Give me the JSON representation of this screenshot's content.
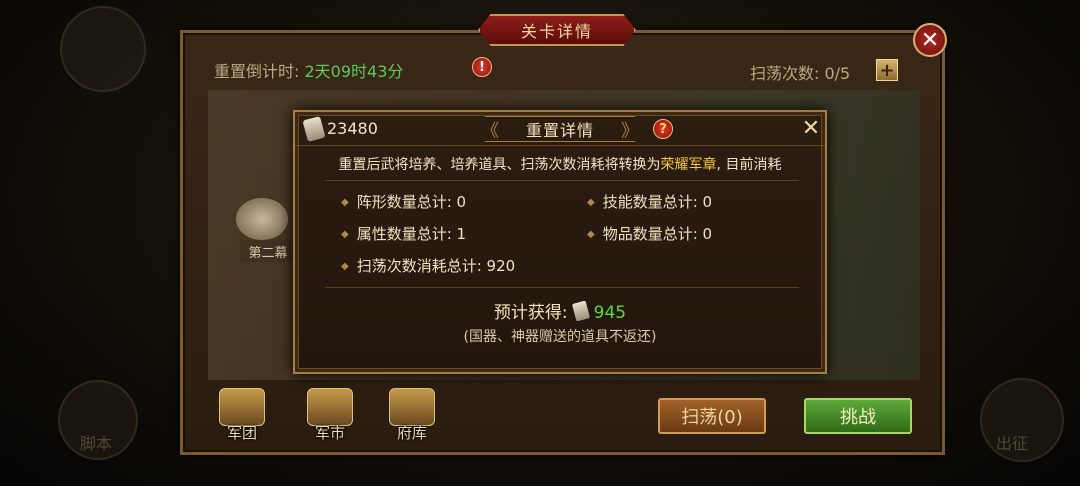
{
  "background": {
    "left_labels": [
      "脚本"
    ],
    "right_labels": [
      "出征"
    ]
  },
  "panel": {
    "title": "关卡详情",
    "reset_label": "重置倒计时:",
    "reset_time": "2天09时43分",
    "sweep_count_label": "扫荡次数: 0/5",
    "chapter_label": "第二幕",
    "bottom_icons": [
      "军团",
      "军市",
      "府库"
    ],
    "sweep_button": "扫荡(0)",
    "fight_button": "挑战"
  },
  "dialog": {
    "token_count": "23480",
    "title": "重置详情",
    "description_prefix": "重置后武将培养、培养道具、扫荡次数消耗将转换为",
    "description_highlight": "荣耀军章",
    "description_suffix": ", 目前消耗",
    "stats": {
      "formation": "阵形数量总计: 0",
      "skill": "技能数量总计: 0",
      "attribute": "属性数量总计: 1",
      "item": "物品数量总计: 0",
      "sweep": "扫荡次数消耗总计: 920"
    },
    "gain_label": "预计获得:",
    "gain_value": "945",
    "note": "(国器、神器赠送的道具不返还)"
  },
  "colors": {
    "accent_gold": "#a97d40",
    "highlight_yellow": "#f4c63a",
    "gain_green": "#58d84a",
    "timer_green": "#5fc95a",
    "title_red": "#8e1d1a"
  },
  "icons": {
    "close": "close-icon",
    "info": "info-icon",
    "help": "help-icon",
    "plus": "plus-icon",
    "token": "token-icon"
  }
}
